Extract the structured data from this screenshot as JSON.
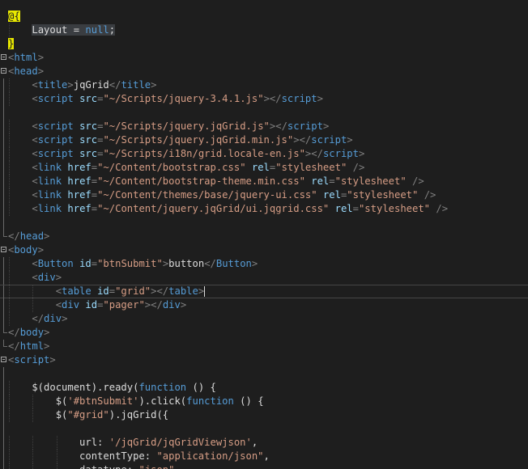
{
  "editor": {
    "lines": [
      {
        "fold": "none",
        "tokens": [
          {
            "t": "@{",
            "c": "razor"
          }
        ]
      },
      {
        "fold": "none",
        "tokens": [
          {
            "t": "    ",
            "c": "plain"
          },
          {
            "t": "Layout",
            "c": "plain",
            "hl": true
          },
          {
            "t": " = ",
            "c": "plain",
            "hl": true
          },
          {
            "t": "null",
            "c": "kw",
            "hl": true
          },
          {
            "t": ";",
            "c": "plain",
            "hl": true
          }
        ]
      },
      {
        "fold": "none",
        "tokens": [
          {
            "t": "}",
            "c": "razor"
          }
        ]
      },
      {
        "fold": "open",
        "tokens": [
          {
            "t": "<",
            "c": "punc"
          },
          {
            "t": "html",
            "c": "tag"
          },
          {
            "t": ">",
            "c": "punc"
          }
        ]
      },
      {
        "fold": "open",
        "tokens": [
          {
            "t": "<",
            "c": "punc"
          },
          {
            "t": "head",
            "c": "tag"
          },
          {
            "t": ">",
            "c": "punc"
          }
        ]
      },
      {
        "fold": "line",
        "tokens": [
          {
            "t": "    ",
            "c": "plain"
          },
          {
            "t": "<",
            "c": "punc"
          },
          {
            "t": "title",
            "c": "tag"
          },
          {
            "t": ">",
            "c": "punc"
          },
          {
            "t": "jqGrid",
            "c": "text"
          },
          {
            "t": "</",
            "c": "punc"
          },
          {
            "t": "title",
            "c": "tag"
          },
          {
            "t": ">",
            "c": "punc"
          }
        ]
      },
      {
        "fold": "line",
        "tokens": [
          {
            "t": "    ",
            "c": "plain"
          },
          {
            "t": "<",
            "c": "punc"
          },
          {
            "t": "script",
            "c": "tag"
          },
          {
            "t": " src",
            "c": "attr"
          },
          {
            "t": "=",
            "c": "punc"
          },
          {
            "t": "\"~/Scripts/jquery-3.4.1.js\"",
            "c": "str"
          },
          {
            "t": "></",
            "c": "punc"
          },
          {
            "t": "script",
            "c": "tag"
          },
          {
            "t": ">",
            "c": "punc"
          }
        ]
      },
      {
        "fold": "line",
        "tokens": []
      },
      {
        "fold": "line",
        "tokens": [
          {
            "t": "    ",
            "c": "plain"
          },
          {
            "t": "<",
            "c": "punc"
          },
          {
            "t": "script",
            "c": "tag"
          },
          {
            "t": " src",
            "c": "attr"
          },
          {
            "t": "=",
            "c": "punc"
          },
          {
            "t": "\"~/Scripts/jquery.jqGrid.js\"",
            "c": "str"
          },
          {
            "t": "></",
            "c": "punc"
          },
          {
            "t": "script",
            "c": "tag"
          },
          {
            "t": ">",
            "c": "punc"
          }
        ]
      },
      {
        "fold": "line",
        "tokens": [
          {
            "t": "    ",
            "c": "plain"
          },
          {
            "t": "<",
            "c": "punc"
          },
          {
            "t": "script",
            "c": "tag"
          },
          {
            "t": " src",
            "c": "attr"
          },
          {
            "t": "=",
            "c": "punc"
          },
          {
            "t": "\"~/Scripts/jquery.jqGrid.min.js\"",
            "c": "str"
          },
          {
            "t": "></",
            "c": "punc"
          },
          {
            "t": "script",
            "c": "tag"
          },
          {
            "t": ">",
            "c": "punc"
          }
        ]
      },
      {
        "fold": "line",
        "tokens": [
          {
            "t": "    ",
            "c": "plain"
          },
          {
            "t": "<",
            "c": "punc"
          },
          {
            "t": "script",
            "c": "tag"
          },
          {
            "t": " src",
            "c": "attr"
          },
          {
            "t": "=",
            "c": "punc"
          },
          {
            "t": "\"~/Scripts/i18n/grid.locale-en.js\"",
            "c": "str"
          },
          {
            "t": "></",
            "c": "punc"
          },
          {
            "t": "script",
            "c": "tag"
          },
          {
            "t": ">",
            "c": "punc"
          }
        ]
      },
      {
        "fold": "line",
        "tokens": [
          {
            "t": "    ",
            "c": "plain"
          },
          {
            "t": "<",
            "c": "punc"
          },
          {
            "t": "link",
            "c": "tag"
          },
          {
            "t": " href",
            "c": "attr"
          },
          {
            "t": "=",
            "c": "punc"
          },
          {
            "t": "\"~/Content/bootstrap.css\"",
            "c": "str"
          },
          {
            "t": " rel",
            "c": "attr"
          },
          {
            "t": "=",
            "c": "punc"
          },
          {
            "t": "\"stylesheet\"",
            "c": "str"
          },
          {
            "t": " />",
            "c": "punc"
          }
        ]
      },
      {
        "fold": "line",
        "tokens": [
          {
            "t": "    ",
            "c": "plain"
          },
          {
            "t": "<",
            "c": "punc"
          },
          {
            "t": "link",
            "c": "tag"
          },
          {
            "t": " href",
            "c": "attr"
          },
          {
            "t": "=",
            "c": "punc"
          },
          {
            "t": "\"~/Content/bootstrap-theme.min.css\"",
            "c": "str"
          },
          {
            "t": " rel",
            "c": "attr"
          },
          {
            "t": "=",
            "c": "punc"
          },
          {
            "t": "\"stylesheet\"",
            "c": "str"
          },
          {
            "t": " />",
            "c": "punc"
          }
        ]
      },
      {
        "fold": "line",
        "tokens": [
          {
            "t": "    ",
            "c": "plain"
          },
          {
            "t": "<",
            "c": "punc"
          },
          {
            "t": "link",
            "c": "tag"
          },
          {
            "t": " href",
            "c": "attr"
          },
          {
            "t": "=",
            "c": "punc"
          },
          {
            "t": "\"~/Content/themes/base/jquery-ui.css\"",
            "c": "str"
          },
          {
            "t": " rel",
            "c": "attr"
          },
          {
            "t": "=",
            "c": "punc"
          },
          {
            "t": "\"stylesheet\"",
            "c": "str"
          },
          {
            "t": " />",
            "c": "punc"
          }
        ]
      },
      {
        "fold": "line",
        "tokens": [
          {
            "t": "    ",
            "c": "plain"
          },
          {
            "t": "<",
            "c": "punc"
          },
          {
            "t": "link",
            "c": "tag"
          },
          {
            "t": " href",
            "c": "attr"
          },
          {
            "t": "=",
            "c": "punc"
          },
          {
            "t": "\"~/Content/jquery.jqGrid/ui.jqgrid.css\"",
            "c": "str"
          },
          {
            "t": " rel",
            "c": "attr"
          },
          {
            "t": "=",
            "c": "punc"
          },
          {
            "t": "\"stylesheet\"",
            "c": "str"
          },
          {
            "t": " />",
            "c": "punc"
          }
        ]
      },
      {
        "fold": "line",
        "tokens": []
      },
      {
        "fold": "end",
        "tokens": [
          {
            "t": "</",
            "c": "punc"
          },
          {
            "t": "head",
            "c": "tag"
          },
          {
            "t": ">",
            "c": "punc"
          }
        ]
      },
      {
        "fold": "open",
        "tokens": [
          {
            "t": "<",
            "c": "punc"
          },
          {
            "t": "body",
            "c": "tag"
          },
          {
            "t": ">",
            "c": "punc"
          }
        ]
      },
      {
        "fold": "line",
        "tokens": [
          {
            "t": "    ",
            "c": "plain"
          },
          {
            "t": "<",
            "c": "punc"
          },
          {
            "t": "Button",
            "c": "tag"
          },
          {
            "t": " id",
            "c": "attr"
          },
          {
            "t": "=",
            "c": "punc"
          },
          {
            "t": "\"btnSubmit\"",
            "c": "str"
          },
          {
            "t": ">",
            "c": "punc"
          },
          {
            "t": "button",
            "c": "text"
          },
          {
            "t": "</",
            "c": "punc"
          },
          {
            "t": "Button",
            "c": "tag"
          },
          {
            "t": ">",
            "c": "punc"
          }
        ]
      },
      {
        "fold": "line",
        "tokens": [
          {
            "t": "    ",
            "c": "plain"
          },
          {
            "t": "<",
            "c": "punc"
          },
          {
            "t": "div",
            "c": "tag"
          },
          {
            "t": ">",
            "c": "punc"
          }
        ]
      },
      {
        "fold": "line",
        "current": true,
        "cursor": true,
        "tokens": [
          {
            "t": "        ",
            "c": "plain"
          },
          {
            "t": "<",
            "c": "punc"
          },
          {
            "t": "table",
            "c": "tag"
          },
          {
            "t": " id",
            "c": "attr"
          },
          {
            "t": "=",
            "c": "punc"
          },
          {
            "t": "\"grid\"",
            "c": "str"
          },
          {
            "t": "></",
            "c": "punc"
          },
          {
            "t": "table",
            "c": "tag"
          },
          {
            "t": ">",
            "c": "punc"
          }
        ]
      },
      {
        "fold": "line",
        "tokens": [
          {
            "t": "        ",
            "c": "plain"
          },
          {
            "t": "<",
            "c": "punc"
          },
          {
            "t": "div",
            "c": "tag"
          },
          {
            "t": " id",
            "c": "attr"
          },
          {
            "t": "=",
            "c": "punc"
          },
          {
            "t": "\"pager\"",
            "c": "str"
          },
          {
            "t": "></",
            "c": "punc"
          },
          {
            "t": "div",
            "c": "tag"
          },
          {
            "t": ">",
            "c": "punc"
          }
        ]
      },
      {
        "fold": "line",
        "tokens": [
          {
            "t": "    ",
            "c": "plain"
          },
          {
            "t": "</",
            "c": "punc"
          },
          {
            "t": "div",
            "c": "tag"
          },
          {
            "t": ">",
            "c": "punc"
          }
        ]
      },
      {
        "fold": "end",
        "tokens": [
          {
            "t": "</",
            "c": "punc"
          },
          {
            "t": "body",
            "c": "tag"
          },
          {
            "t": ">",
            "c": "punc"
          }
        ]
      },
      {
        "fold": "end",
        "tokens": [
          {
            "t": "</",
            "c": "punc"
          },
          {
            "t": "html",
            "c": "tag"
          },
          {
            "t": ">",
            "c": "punc"
          }
        ]
      },
      {
        "fold": "open",
        "tokens": [
          {
            "t": "<",
            "c": "punc"
          },
          {
            "t": "script",
            "c": "tag"
          },
          {
            "t": ">",
            "c": "punc"
          }
        ]
      },
      {
        "fold": "line",
        "tokens": []
      },
      {
        "fold": "line",
        "tokens": [
          {
            "t": "    $(document).ready(",
            "c": "plain"
          },
          {
            "t": "function",
            "c": "kw"
          },
          {
            "t": " () {",
            "c": "plain"
          }
        ]
      },
      {
        "fold": "line",
        "tokens": [
          {
            "t": "        $(",
            "c": "plain"
          },
          {
            "t": "'#btnSubmit'",
            "c": "str"
          },
          {
            "t": ").click(",
            "c": "plain"
          },
          {
            "t": "function",
            "c": "kw"
          },
          {
            "t": " () {",
            "c": "plain"
          }
        ]
      },
      {
        "fold": "line",
        "tokens": [
          {
            "t": "        $(",
            "c": "plain"
          },
          {
            "t": "\"#grid\"",
            "c": "str"
          },
          {
            "t": ").jqGrid({",
            "c": "plain"
          }
        ]
      },
      {
        "fold": "line",
        "tokens": []
      },
      {
        "fold": "line",
        "tokens": [
          {
            "t": "            url: ",
            "c": "plain"
          },
          {
            "t": "'/jqGrid/jqGridViewjson'",
            "c": "str"
          },
          {
            "t": ",",
            "c": "plain"
          }
        ]
      },
      {
        "fold": "line",
        "tokens": [
          {
            "t": "            contentType: ",
            "c": "plain"
          },
          {
            "t": "\"application/json\"",
            "c": "str"
          },
          {
            "t": ",",
            "c": "plain"
          }
        ]
      },
      {
        "fold": "line",
        "tokens": [
          {
            "t": "            datatype: ",
            "c": "plain"
          },
          {
            "t": "\"json\"",
            "c": "str"
          },
          {
            "t": ",",
            "c": "plain"
          }
        ]
      }
    ]
  }
}
